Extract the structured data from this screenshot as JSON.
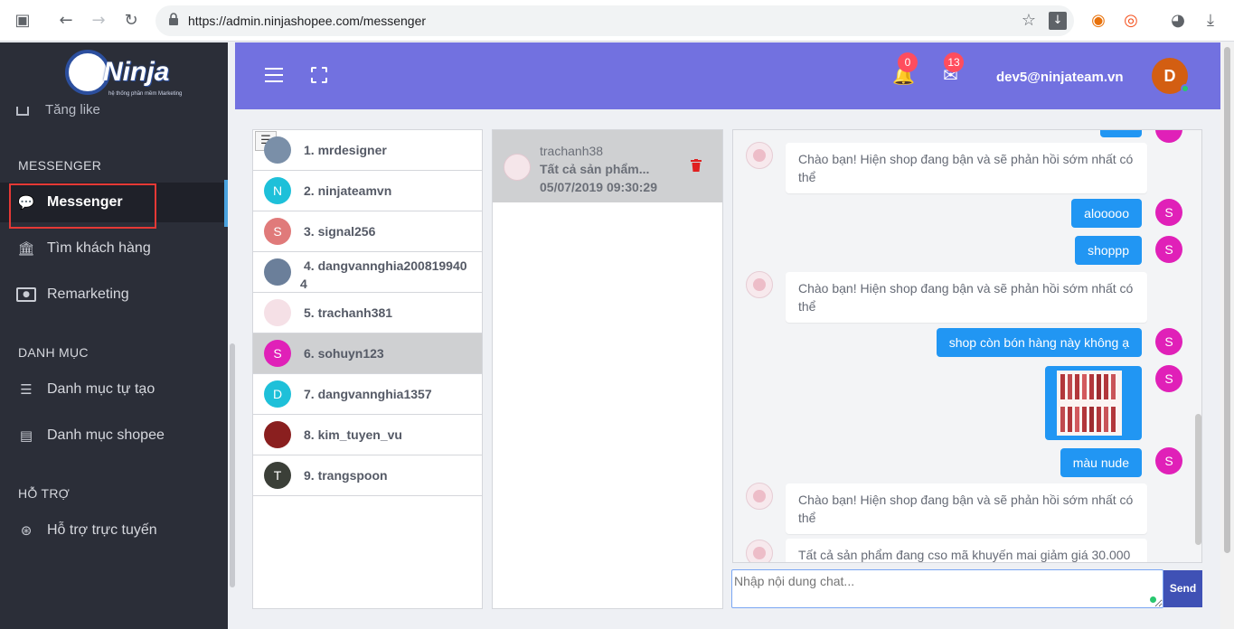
{
  "browser": {
    "url": "https://admin.ninjashopee.com/messenger"
  },
  "sidebar": {
    "logo_text": "Ninja",
    "logo_tagline": "hệ thống phần mềm Marketing",
    "partial_item": "Tăng like",
    "sections": {
      "messenger": "MESSENGER",
      "danh_muc": "DANH MỤC",
      "ho_tro": "HỖ TRỢ"
    },
    "items": [
      {
        "label": "Messenger",
        "icon": "chat-bubbles-icon"
      },
      {
        "label": "Tìm khách hàng",
        "icon": "bank-icon"
      },
      {
        "label": "Remarketing",
        "icon": "money-icon"
      },
      {
        "label": "Danh mục tự tạo",
        "icon": "list-icon"
      },
      {
        "label": "Danh mục shopee",
        "icon": "list-alt-icon"
      },
      {
        "label": "Hỗ trợ trực tuyến",
        "icon": "lifebuoy-icon"
      }
    ]
  },
  "topbar": {
    "notifications_count": "0",
    "messages_count": "13",
    "user_email": "dev5@ninjateam.vn",
    "avatar_letter": "D"
  },
  "contacts": [
    {
      "name": "1. mrdesigner",
      "avatar": "",
      "color": "#7a8fa8"
    },
    {
      "name": "2. ninjateamvn",
      "avatar": "N",
      "color": "#1ec0d9"
    },
    {
      "name": "3. signal256",
      "avatar": "S",
      "color": "#e07a7a"
    },
    {
      "name": "4. dangvannghia2008199404",
      "avatar": "",
      "color": "#6b7f9a"
    },
    {
      "name": "5. trachanh381",
      "avatar": "",
      "color": "#f5e0e6"
    },
    {
      "name": "6. sohuyn123",
      "avatar": "S",
      "color": "#e020b8"
    },
    {
      "name": "7. dangvannghia1357",
      "avatar": "D",
      "color": "#1ec0d9"
    },
    {
      "name": "8. kim_tuyen_vu",
      "avatar": "",
      "color": "#8a1f1f"
    },
    {
      "name": "9. trangspoon",
      "avatar": "T",
      "color": "#3b3f38"
    }
  ],
  "conversation": {
    "name": "trachanh38",
    "preview": "Tất cả sản phẩm...",
    "time": "05/07/2019 09:30:29"
  },
  "chat": {
    "messages": [
      {
        "side": "left",
        "text": "Chào bạn! Hiện shop đang bận và sẽ phản hồi sớm nhất có thể"
      },
      {
        "side": "right",
        "text": "alooooo"
      },
      {
        "side": "right",
        "text": "shoppp"
      },
      {
        "side": "left",
        "text": "Chào bạn! Hiện shop đang bận và sẽ phản hồi sớm nhất có thể"
      },
      {
        "side": "right",
        "text": "shop còn bón hàng này không ạ"
      },
      {
        "side": "right",
        "text": "màu nude"
      },
      {
        "side": "left",
        "text": "Chào bạn! Hiện shop đang bận và sẽ phản hồi sớm nhất có thể"
      },
      {
        "side": "left",
        "text": "Tất cả sản phẩm đang cso mã khuyến mai giảm giá 30.000"
      }
    ],
    "sender_avatar": "S",
    "input_placeholder": "Nhập nội dung chat...",
    "send_label": "Send"
  }
}
